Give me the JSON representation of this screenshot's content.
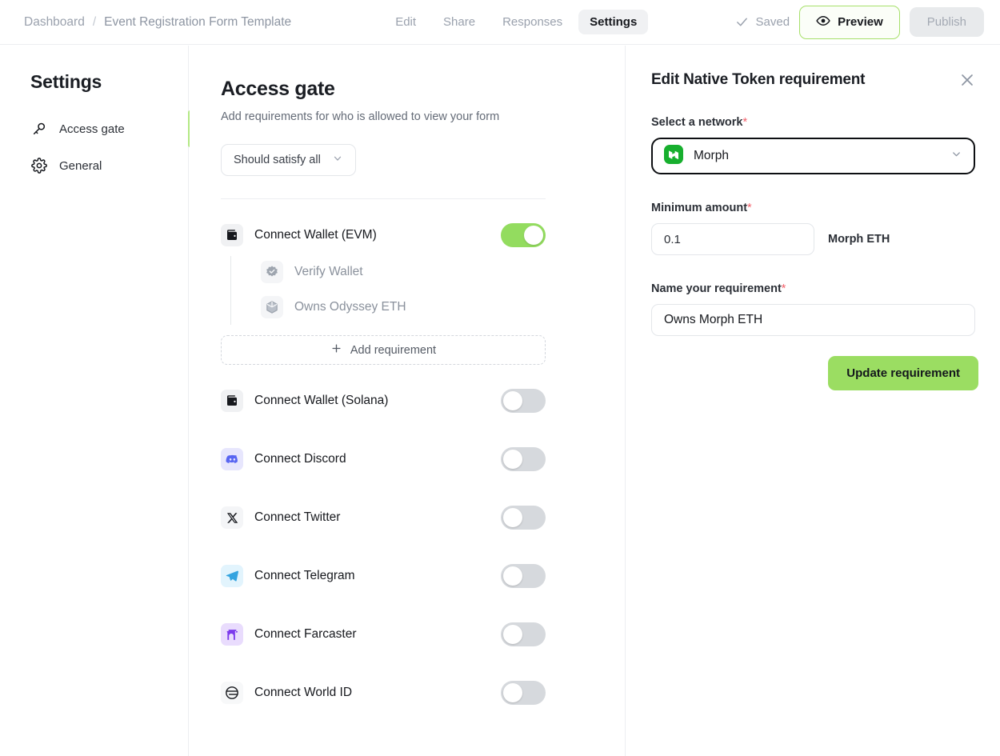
{
  "topbar": {
    "breadcrumb": {
      "root": "Dashboard",
      "separator": "/",
      "current": "Event Registration Form Template"
    },
    "tabs": [
      {
        "label": "Edit",
        "active": false
      },
      {
        "label": "Share",
        "active": false
      },
      {
        "label": "Responses",
        "active": false
      },
      {
        "label": "Settings",
        "active": true
      }
    ],
    "saved_label": "Saved",
    "saved_icon": "check-icon",
    "preview_label": "Preview",
    "preview_icon": "eye-icon",
    "publish_label": "Publish"
  },
  "sidebar": {
    "title": "Settings",
    "items": [
      {
        "label": "Access gate",
        "icon": "key-icon",
        "active": true
      },
      {
        "label": "General",
        "icon": "gear-icon",
        "active": false
      }
    ],
    "active_marker_color": "#b3e884"
  },
  "main": {
    "title": "Access gate",
    "subtitle": "Add requirements for who is allowed to view your form",
    "logic_select": {
      "value": "Should satisfy all",
      "icon": "chevron-down-icon"
    },
    "requirements": [
      {
        "label": "Connect Wallet (EVM)",
        "icon": "wallet-icon",
        "tile": "tile-gray",
        "enabled": true,
        "children": [
          {
            "label": "Verify Wallet",
            "icon": "badge-check-icon"
          },
          {
            "label": "Owns Odyssey ETH",
            "icon": "cube-icon"
          }
        ],
        "add_label": "Add requirement",
        "add_icon": "plus-icon"
      },
      {
        "label": "Connect Wallet (Solana)",
        "icon": "wallet-icon",
        "tile": "tile-gray",
        "enabled": false
      },
      {
        "label": "Connect Discord",
        "icon": "discord-icon",
        "tile": "tile-discord",
        "enabled": false
      },
      {
        "label": "Connect Twitter",
        "icon": "x-twitter-icon",
        "tile": "tile-tw",
        "enabled": false
      },
      {
        "label": "Connect Telegram",
        "icon": "telegram-icon",
        "tile": "tile-tg",
        "enabled": false
      },
      {
        "label": "Connect Farcaster",
        "icon": "farcaster-icon",
        "tile": "tile-fc",
        "enabled": false
      },
      {
        "label": "Connect World ID",
        "icon": "worldid-icon",
        "tile": "tile-wid",
        "enabled": false
      }
    ]
  },
  "panel": {
    "title": "Edit Native Token requirement",
    "close_icon": "close-icon",
    "network_label": "Select a network",
    "network_required": "*",
    "network_value": "Morph",
    "network_icon": "morph-icon",
    "network_chevron": "chevron-down-icon",
    "amount_label": "Minimum amount",
    "amount_required": "*",
    "amount_value": "0.1",
    "amount_unit": "Morph ETH",
    "name_label": "Name your requirement",
    "name_required": "*",
    "name_value": "Owns Morph ETH",
    "submit_label": "Update requirement"
  },
  "colors": {
    "accent_green": "#9bdd62",
    "toggle_on": "#93dc5f",
    "required_star": "#f2606a",
    "morph_green": "#17af2e"
  }
}
